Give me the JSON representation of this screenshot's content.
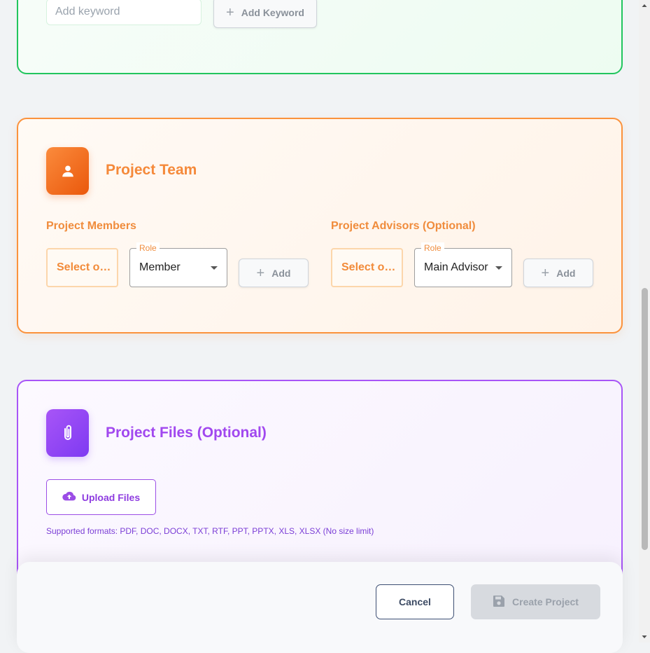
{
  "keywords": {
    "input_placeholder": "Add keyword",
    "add_button_label": "Add Keyword"
  },
  "team": {
    "title": "Project Team",
    "icon": "user-icon",
    "members": {
      "label": "Project Members",
      "select_text": "Select o…",
      "role_legend": "Role",
      "role_value": "Member",
      "add_label": "Add"
    },
    "advisors": {
      "label": "Project Advisors (Optional)",
      "select_text": "Select o…",
      "role_legend": "Role",
      "role_value": "Main Advisor",
      "add_label": "Add"
    }
  },
  "files": {
    "title": "Project Files (Optional)",
    "icon": "paperclip-icon",
    "upload_label": "Upload Files",
    "formats": "Supported formats: PDF, DOC, DOCX, TXT, RTF, PPT, PPTX, XLS, XLSX (No size limit)"
  },
  "footer": {
    "cancel_label": "Cancel",
    "create_label": "Create Project"
  },
  "colors": {
    "keywords_accent": "#22c55e",
    "team_accent": "#fb923c",
    "files_accent": "#a855f7",
    "cancel_border": "#3d4f73",
    "create_disabled": "#d7dadf"
  }
}
